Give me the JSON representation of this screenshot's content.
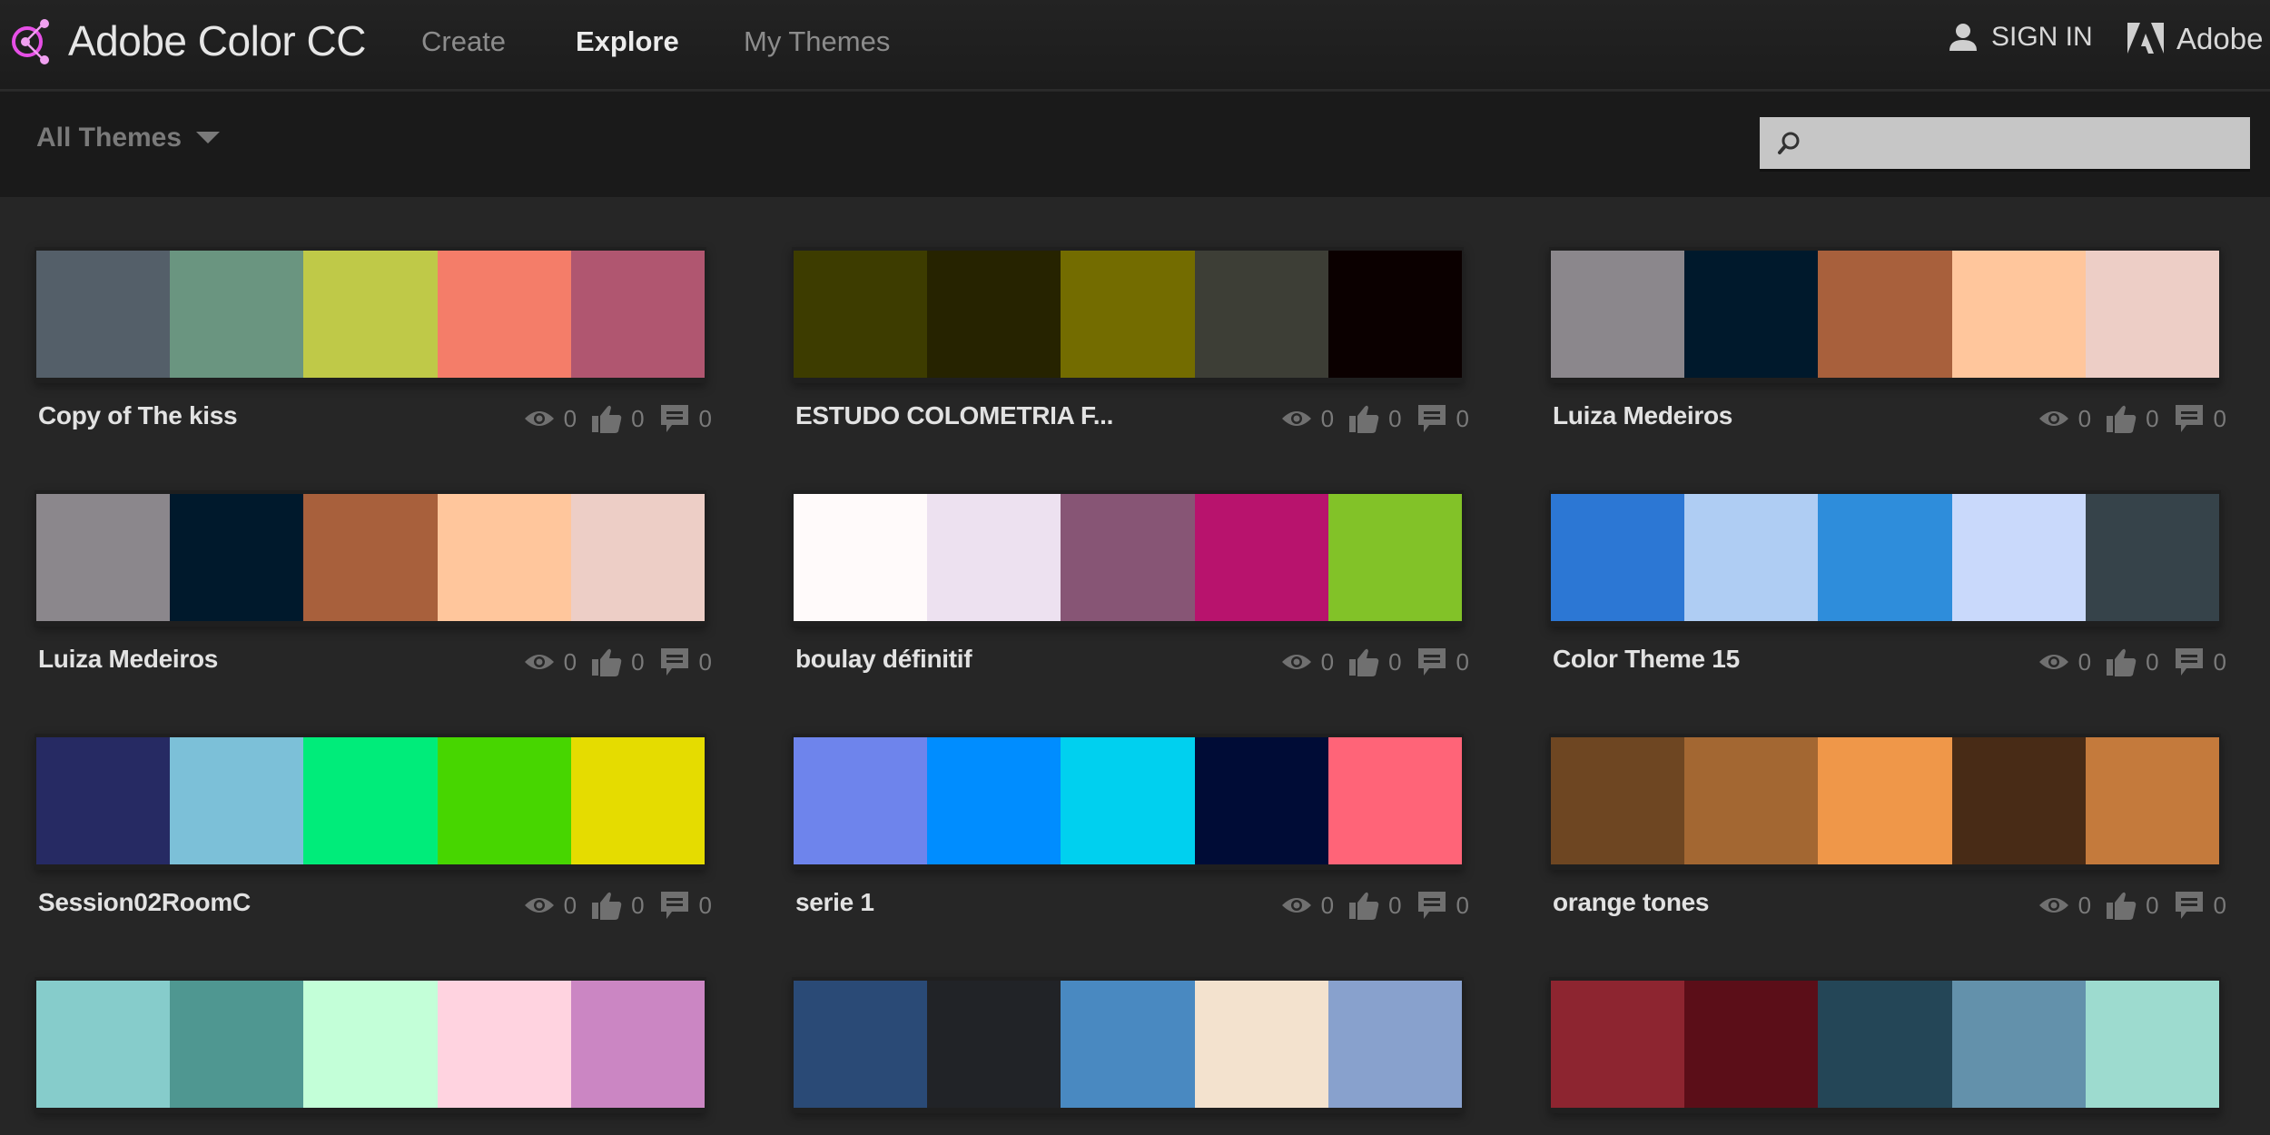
{
  "header": {
    "brand": "Adobe Color CC",
    "accent_color": "#e64fe6",
    "nav": [
      {
        "label": "Create",
        "active": false
      },
      {
        "label": "Explore",
        "active": true
      },
      {
        "label": "My Themes",
        "active": false
      }
    ],
    "sign_in_label": "SIGN IN",
    "adobe_label": "Adobe"
  },
  "filterbar": {
    "filter_label": "All Themes",
    "search_placeholder": "",
    "search_value": ""
  },
  "themes": [
    {
      "name": "Copy of The kiss",
      "views": "0",
      "likes": "0",
      "comments": "0",
      "colors": [
        "#545f69",
        "#6a9580",
        "#bfc948",
        "#f47d69",
        "#b05670"
      ]
    },
    {
      "name": "ESTUDO COLOMETRIA F...",
      "views": "0",
      "likes": "0",
      "comments": "0",
      "colors": [
        "#3d3c00",
        "#262300",
        "#736c00",
        "#3d3e36",
        "#0b0000"
      ]
    },
    {
      "name": "Luiza Medeiros",
      "views": "0",
      "likes": "0",
      "comments": "0",
      "colors": [
        "#8b878c",
        "#00192c",
        "#a8603c",
        "#ffc69c",
        "#edcec6"
      ]
    },
    {
      "name": "Luiza Medeiros",
      "views": "0",
      "likes": "0",
      "comments": "0",
      "colors": [
        "#8b878c",
        "#00192c",
        "#a8603c",
        "#ffc69c",
        "#edcec6"
      ]
    },
    {
      "name": "boulay définitif",
      "views": "0",
      "likes": "0",
      "comments": "0",
      "colors": [
        "#fffafa",
        "#ede1f0",
        "#875575",
        "#b8136d",
        "#82c228"
      ]
    },
    {
      "name": "Color Theme 15",
      "views": "0",
      "likes": "0",
      "comments": "0",
      "colors": [
        "#2c77d4",
        "#afcdf3",
        "#2e8ddb",
        "#c9d9fb",
        "#36434a"
      ]
    },
    {
      "name": "Session02RoomC",
      "views": "0",
      "likes": "0",
      "comments": "0",
      "colors": [
        "#262a63",
        "#7cc0d8",
        "#00ec7a",
        "#47d600",
        "#e5dc00"
      ]
    },
    {
      "name": "serie 1",
      "views": "0",
      "likes": "0",
      "comments": "0",
      "colors": [
        "#6e84ec",
        "#008dff",
        "#00d0ef",
        "#000c36",
        "#ff6478"
      ]
    },
    {
      "name": "orange tones",
      "views": "0",
      "likes": "0",
      "comments": "0",
      "colors": [
        "#6e4622",
        "#a36732",
        "#ef9749",
        "#482b16",
        "#c47a3c"
      ]
    },
    {
      "name": "",
      "views": "",
      "likes": "",
      "comments": "",
      "colors": [
        "#86cccb",
        "#4f9791",
        "#c3ffd8",
        "#ffd3e0",
        "#cb86c3"
      ]
    },
    {
      "name": "",
      "views": "",
      "likes": "",
      "comments": "",
      "colors": [
        "#2a4a76",
        "#212327",
        "#4989c1",
        "#f3e2ce",
        "#88a1cd"
      ]
    },
    {
      "name": "",
      "views": "",
      "likes": "",
      "comments": "",
      "colors": [
        "#8d2530",
        "#5b0e18",
        "#244657",
        "#6391ab",
        "#9ddbcf"
      ]
    }
  ],
  "icons": {
    "views": "eye-icon",
    "likes": "thumbs-up-icon",
    "comments": "comment-icon",
    "search": "search-icon",
    "user": "user-icon",
    "dropdown": "caret-down-icon"
  }
}
